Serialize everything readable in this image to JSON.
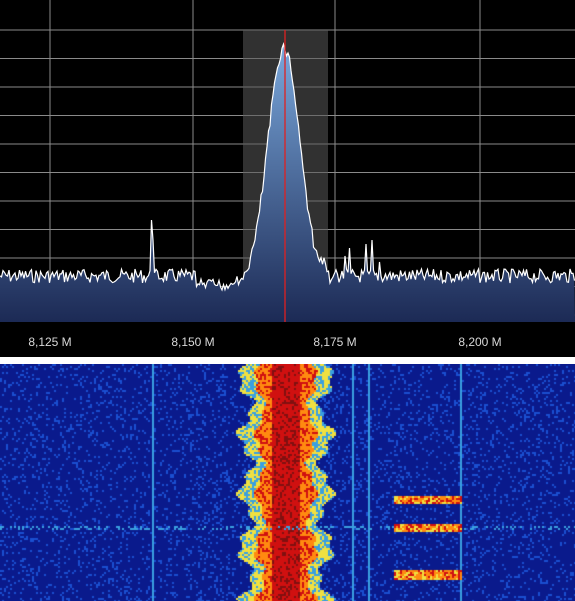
{
  "app": {
    "panels": [
      "spectrum",
      "waterfall"
    ]
  },
  "spectrum": {
    "frequency_axis": {
      "ticks": [
        "8,125 M",
        "8,150 M",
        "8,175 M",
        "8,200 M"
      ]
    },
    "selected_band_label": "",
    "colors": {
      "background": "#000000",
      "grid": "#8a8a8a",
      "trace": "#ffffff",
      "fill_top": "#7aa8dc",
      "fill_bottom": "#1c2a55",
      "selection": "#5a5a5a",
      "center_marker": "#e02020"
    }
  },
  "waterfall": {
    "palette": [
      "#0a1a8c",
      "#1a4fd0",
      "#3aa0e0",
      "#f0e040",
      "#ff8a10",
      "#d01010",
      "#801010"
    ]
  }
}
